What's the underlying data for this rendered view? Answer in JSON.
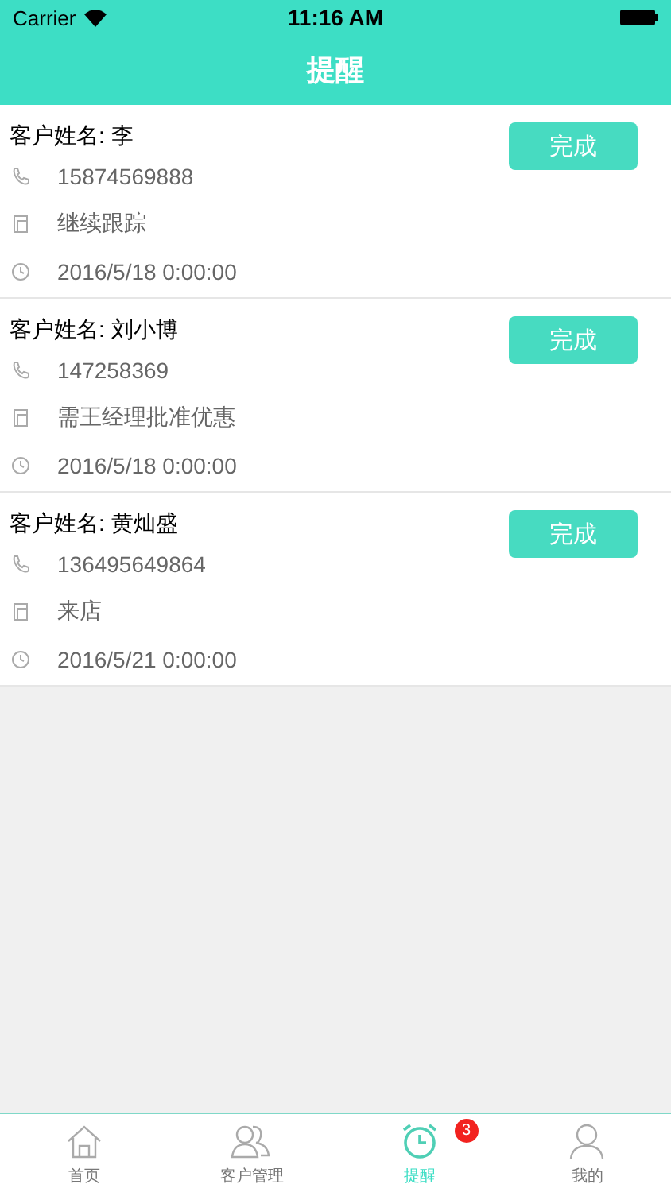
{
  "status_bar": {
    "carrier": "Carrier",
    "time": "11:16 AM"
  },
  "nav": {
    "title": "提醒"
  },
  "reminders": [
    {
      "customer": "客户姓名: 李",
      "phone": "15874569888",
      "note": "继续跟踪",
      "time": "2016/5/18 0:00:00",
      "action": "完成"
    },
    {
      "customer": "客户姓名: 刘小博",
      "phone": "147258369",
      "note": "需王经理批准优惠",
      "time": "2016/5/18 0:00:00",
      "action": "完成"
    },
    {
      "customer": "客户姓名: 黄灿盛",
      "phone": "136495649864",
      "note": "来店",
      "time": "2016/5/21 0:00:00",
      "action": "完成"
    }
  ],
  "tabs": [
    {
      "label": "首页",
      "selected": false
    },
    {
      "label": "客户管理",
      "selected": false
    },
    {
      "label": "提醒",
      "selected": true,
      "badge": "3"
    },
    {
      "label": "我的",
      "selected": false
    }
  ]
}
